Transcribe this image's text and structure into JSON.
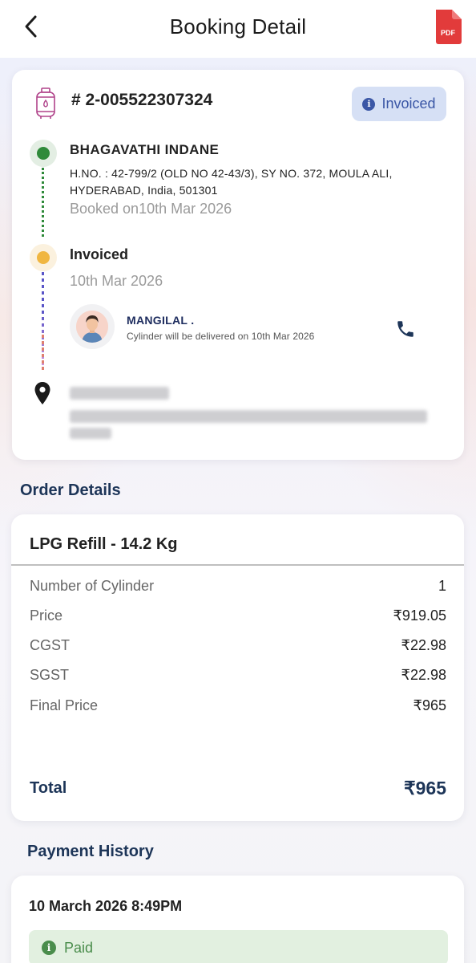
{
  "header": {
    "title": "Booking Detail",
    "pdf_label": "PDF"
  },
  "booking": {
    "id": "# 2-005522307324",
    "status": "Invoiced",
    "distributor": {
      "name": "BHAGAVATHI INDANE",
      "address": "H.NO. : 42-799/2 (OLD NO 42-43/3), SY NO. 372, MOULA ALI, HYDERABAD, India, 501301",
      "booked_on": "Booked on10th Mar 2026"
    },
    "step": {
      "label": "Invoiced",
      "date": "10th Mar 2026"
    },
    "delivery": {
      "driver_name": "MANGILAL .",
      "note": "Cylinder will be delivered on 10th Mar 2026"
    }
  },
  "order": {
    "section_title": "Order Details",
    "product": "LPG Refill - 14.2 Kg",
    "rows": [
      {
        "label": "Number of Cylinder",
        "value": "1"
      },
      {
        "label": "Price",
        "value": "₹919.05"
      },
      {
        "label": "CGST",
        "value": "₹22.98"
      },
      {
        "label": "SGST",
        "value": "₹22.98"
      },
      {
        "label": "Final Price",
        "value": "₹965"
      }
    ],
    "total_label": "Total",
    "total_value": "₹965"
  },
  "payment": {
    "section_title": "Payment History",
    "date": "10 March 2026 8:49PM",
    "status": "Paid"
  },
  "colors": {
    "accent_navy": "#1d3558",
    "status_blue": "#3b57a6",
    "paid_green": "#4a8d4c",
    "timeline_green": "#2f8a3a",
    "timeline_yellow": "#f0b640"
  }
}
